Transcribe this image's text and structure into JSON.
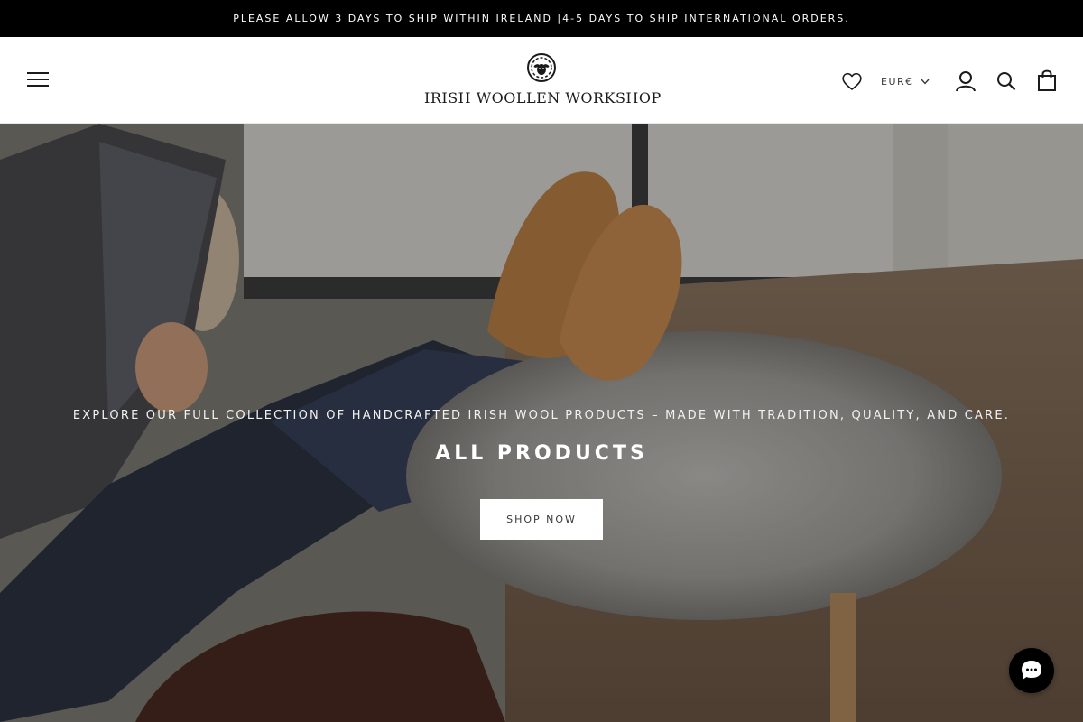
{
  "announcement": {
    "text": "PLEASE ALLOW 3 DAYS TO SHIP WITHIN IRELAND |4-5 DAYS TO SHIP INTERNATIONAL ORDERS."
  },
  "header": {
    "menu_icon": "hamburger-menu-icon",
    "logo_text": "IRISH WOOLLEN WORKSHOP",
    "logo_icon": "sheep-logo-icon",
    "wishlist_icon": "heart-icon",
    "currency": "EUR€",
    "currency_icon": "chevron-down-icon",
    "account_icon": "account-icon",
    "search_icon": "search-icon",
    "cart_icon": "shopping-bag-icon"
  },
  "hero": {
    "subtitle": "EXPLORE OUR FULL COLLECTION OF HANDCRAFTED IRISH WOOL PRODUCTS – MADE WITH TRADITION, QUALITY, AND CARE.",
    "title": "ALL PRODUCTS",
    "button": "SHOP NOW"
  },
  "chat": {
    "icon": "chat-bubble-icon"
  },
  "colors": {
    "announcement_bg": "#000000",
    "text_dark": "#1c1b1b",
    "hero_text": "#ffffff"
  }
}
